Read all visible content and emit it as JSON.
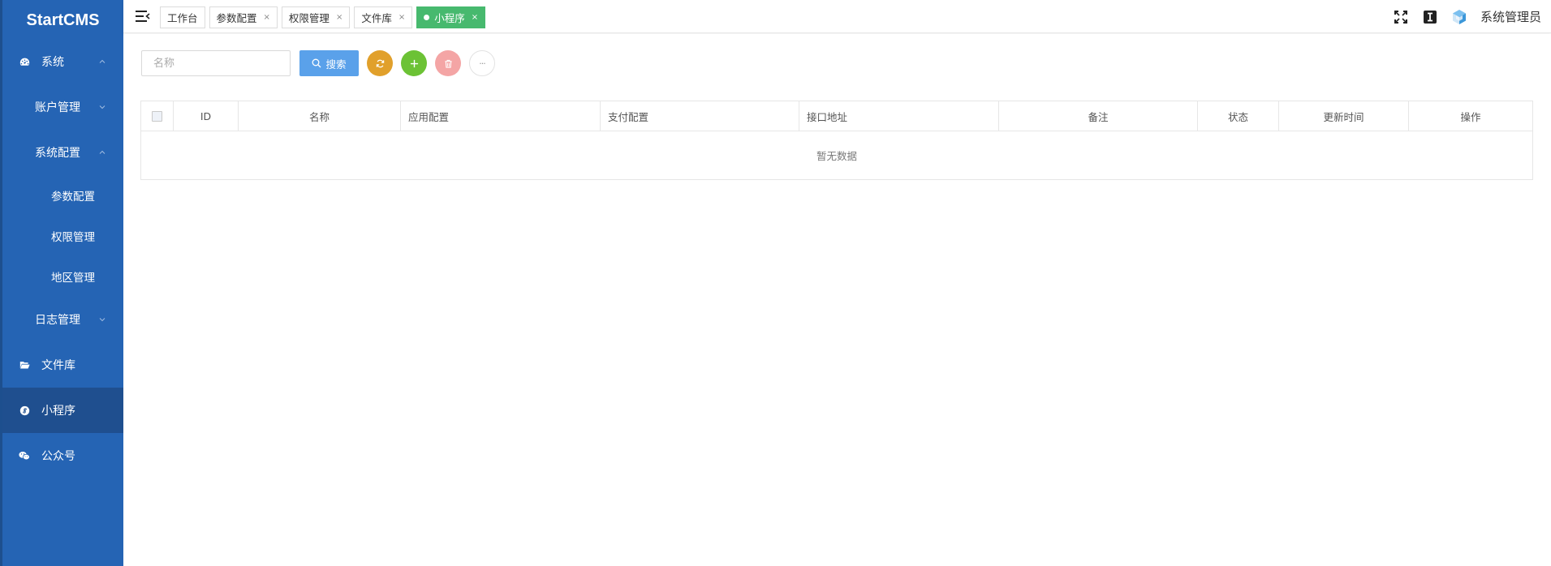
{
  "app": {
    "logo": "StartCMS"
  },
  "sidebar": {
    "items": [
      {
        "label": "系统",
        "icon": "dashboard-icon"
      },
      {
        "label": "账户管理"
      },
      {
        "label": "系统配置"
      },
      {
        "label": "参数配置"
      },
      {
        "label": "权限管理"
      },
      {
        "label": "地区管理"
      },
      {
        "label": "日志管理"
      },
      {
        "label": "文件库",
        "icon": "folder-open-icon"
      },
      {
        "label": "小程序",
        "icon": "mini-program-icon",
        "active": true
      },
      {
        "label": "公众号",
        "icon": "wechat-icon"
      }
    ]
  },
  "header": {
    "tabs": [
      {
        "label": "工作台",
        "closable": false
      },
      {
        "label": "参数配置",
        "close": "×"
      },
      {
        "label": "权限管理",
        "close": "×"
      },
      {
        "label": "文件库",
        "close": "×"
      },
      {
        "label": "小程序",
        "close": "×",
        "active": true
      }
    ],
    "user": "系统管理员"
  },
  "toolbar": {
    "search_placeholder": "名称",
    "search_label": "搜索",
    "more_label": "···"
  },
  "table": {
    "columns": [
      "ID",
      "名称",
      "应用配置",
      "支付配置",
      "接口地址",
      "备注",
      "状态",
      "更新时间",
      "操作"
    ],
    "empty_text": "暂无数据"
  },
  "colors": {
    "sidebar": "#2564b4",
    "active_tab": "#47b96e",
    "search_button": "#5aa1ea",
    "refresh": "#e1a02b",
    "add": "#6cc235",
    "delete": "#f4a5a5"
  }
}
